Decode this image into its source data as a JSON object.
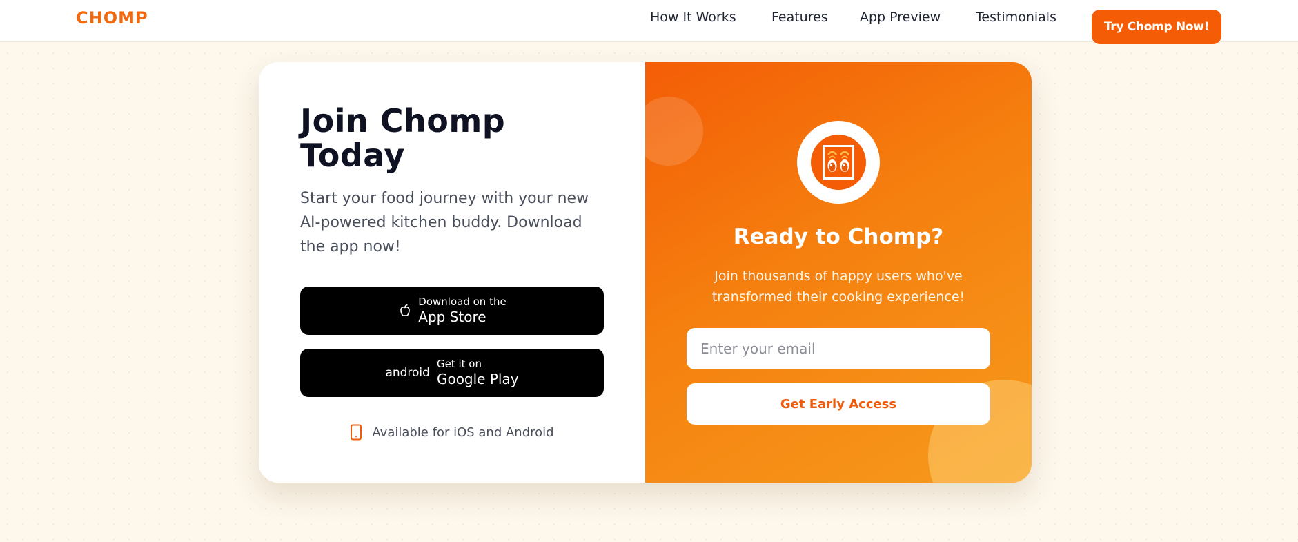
{
  "brand": {
    "logo": "CHOMP",
    "accent": "#f45c06"
  },
  "nav": {
    "links": [
      "How It Works",
      "Features",
      "App Preview",
      "Testimonials"
    ],
    "cta": "Try Chomp Now!"
  },
  "join": {
    "title": "Join Chomp Today",
    "subtitle": "Start your food journey with your new AI-powered kitchen buddy. Download the app now!",
    "appstore": {
      "icon": "apple-icon",
      "small": "Download on the",
      "big": "App Store"
    },
    "googleplay": {
      "icon_text": "android",
      "small": "Get it on",
      "big": "Google Play"
    },
    "availability": {
      "icon": "smartphone-icon",
      "text": "Available for iOS and Android"
    }
  },
  "signup": {
    "icon": "chomp-eyes-mascot",
    "title": "Ready to Chomp?",
    "text": "Join thousands of happy users who've transformed their cooking experience!",
    "email_placeholder": "Enter your email",
    "button": "Get Early Access"
  }
}
